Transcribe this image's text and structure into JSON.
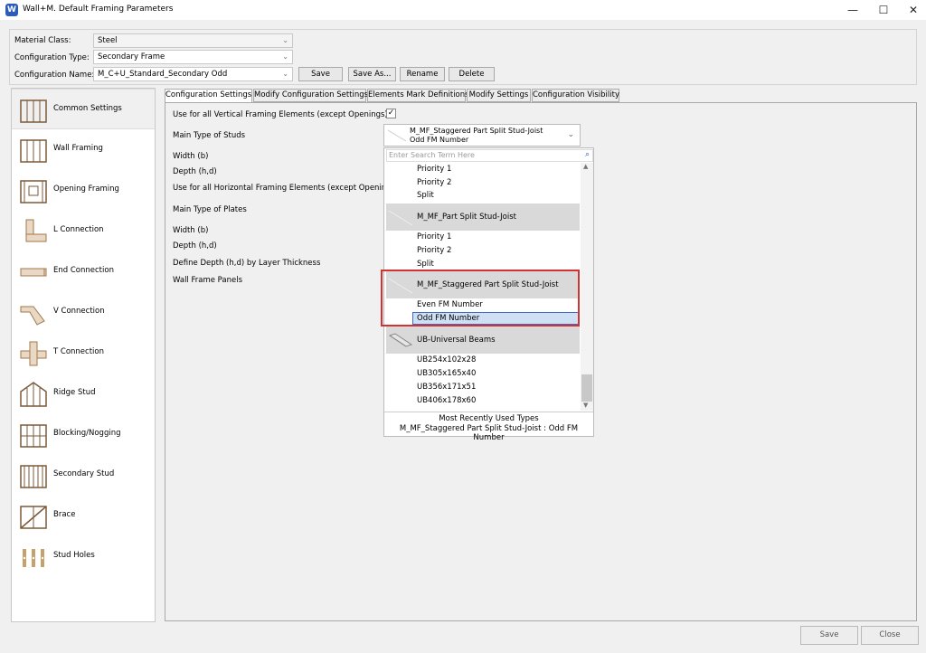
{
  "window": {
    "title": "Wall+M. Default Framing Parameters",
    "app_icon_letter": "W",
    "min_glyph": "—",
    "max_glyph": "☐",
    "close_glyph": "✕"
  },
  "config": {
    "material_class_label": "Material Class:",
    "material_class_value": "Steel",
    "configuration_type_label": "Configuration Type:",
    "configuration_type_value": "Secondary Frame",
    "configuration_name_label": "Configuration Name:",
    "configuration_name_value": "M_C+U_Standard_Secondary Odd",
    "buttons": {
      "save": "Save",
      "save_as": "Save As...",
      "rename": "Rename",
      "delete": "Delete"
    }
  },
  "sidebar": {
    "items": [
      {
        "label": "Common Settings",
        "icon": "common-settings-icon"
      },
      {
        "label": "Wall Framing",
        "icon": "wall-framing-icon"
      },
      {
        "label": "Opening Framing",
        "icon": "opening-framing-icon"
      },
      {
        "label": "L Connection",
        "icon": "l-connection-icon"
      },
      {
        "label": "End Connection",
        "icon": "end-connection-icon"
      },
      {
        "label": "V Connection",
        "icon": "v-connection-icon"
      },
      {
        "label": "T Connection",
        "icon": "t-connection-icon"
      },
      {
        "label": "Ridge Stud",
        "icon": "ridge-stud-icon"
      },
      {
        "label": "Blocking/Nogging",
        "icon": "blocking-nogging-icon"
      },
      {
        "label": "Secondary Stud",
        "icon": "secondary-stud-icon"
      },
      {
        "label": "Brace",
        "icon": "brace-icon"
      },
      {
        "label": "Stud Holes",
        "icon": "stud-holes-icon"
      }
    ]
  },
  "tabs": [
    {
      "label": "Configuration Settings"
    },
    {
      "label": "Modify Configuration Settings"
    },
    {
      "label": "Elements Mark Definitions"
    },
    {
      "label": "Modify Settings"
    },
    {
      "label": "Configuration Visibility"
    }
  ],
  "settings": {
    "use_vertical": "Use for all Vertical Framing Elements (except Openings)",
    "use_vertical_checked": "✓",
    "main_type_studs": "Main Type of Studs",
    "width_b_1": "Width (b)",
    "depth_hd_1": "Depth (h,d)",
    "use_horizontal": "Use for all Horizontal Framing Elements (except Openings)",
    "main_type_plates": "Main Type of Plates",
    "width_b_2": "Width (b)",
    "depth_hd_2": "Depth (h,d)",
    "define_depth": "Define Depth (h,d) by Layer Thickness",
    "wall_frame_panels": "Wall Frame Panels"
  },
  "stud_combo": {
    "line1": "M_MF_Staggered Part Split Stud-Joist",
    "line2": "Odd FM Number"
  },
  "dropdown": {
    "search_placeholder": "Enter Search Term Here",
    "top_items": [
      "Priority 1",
      "Priority 2",
      "Split"
    ],
    "group1": "M_MF_Part Split Stud-Joist",
    "group1_items": [
      "Priority 1",
      "Priority 2",
      "Split"
    ],
    "group2": "M_MF_Staggered Part Split Stud-Joist",
    "group2_items": [
      "Even FM Number",
      "Odd FM Number"
    ],
    "group3": "UB-Universal Beams",
    "group3_items": [
      "UB254x102x28",
      "UB305x165x40",
      "UB356x171x51",
      "UB406x178x60"
    ],
    "recent_header": "Most Recently Used Types",
    "recent_item": "M_MF_Staggered Part Split Stud-Joist : Odd FM Number"
  },
  "footer": {
    "save": "Save",
    "close": "Close"
  },
  "colors": {
    "highlight": "#d23232",
    "selection": "#cfe0f4",
    "accent": "#2a5db8"
  }
}
